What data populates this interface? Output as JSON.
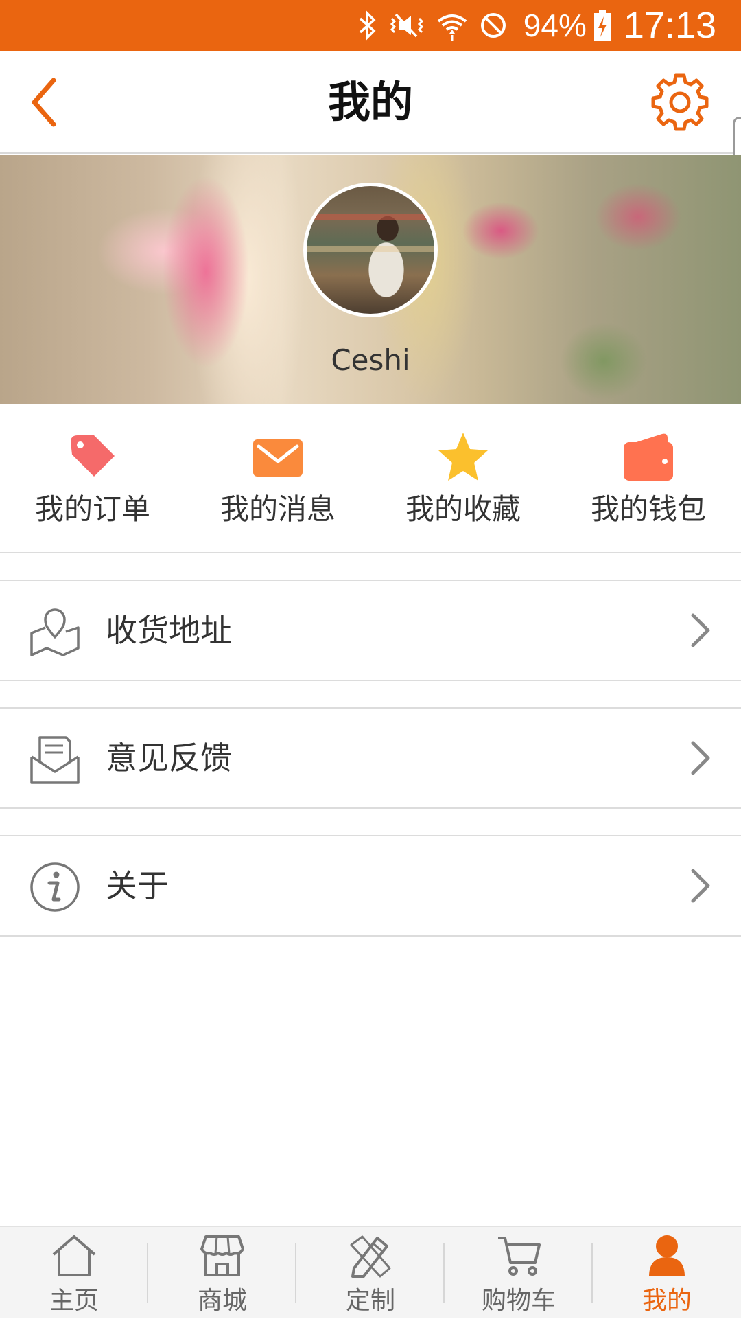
{
  "status_bar": {
    "battery": "94%",
    "time": "17:13",
    "icons": [
      "bluetooth-icon",
      "vibrate-icon",
      "wifi-icon",
      "do-not-disturb-icon",
      "battery-charging-icon"
    ]
  },
  "header": {
    "title": "我的",
    "back_icon": "chevron-left-icon",
    "settings_icon": "gear-icon"
  },
  "profile": {
    "username": "Ceshi"
  },
  "quick_actions": [
    {
      "label": "我的订单",
      "icon": "tag-icon",
      "color": "#f56a6a"
    },
    {
      "label": "我的消息",
      "icon": "mail-icon",
      "color": "#fa8a3c"
    },
    {
      "label": "我的收藏",
      "icon": "star-icon",
      "color": "#fbc02d"
    },
    {
      "label": "我的钱包",
      "icon": "wallet-icon",
      "color": "#ff7250"
    }
  ],
  "menu": [
    {
      "label": "收货地址",
      "icon": "map-pin-icon"
    },
    {
      "label": "意见反馈",
      "icon": "envelope-open-icon"
    },
    {
      "label": "关于",
      "icon": "info-icon"
    }
  ],
  "tabs": [
    {
      "label": "主页",
      "icon": "home-icon",
      "active": false
    },
    {
      "label": "商城",
      "icon": "store-icon",
      "active": false
    },
    {
      "label": "定制",
      "icon": "pencil-ruler-icon",
      "active": false
    },
    {
      "label": "购物车",
      "icon": "cart-icon",
      "active": false
    },
    {
      "label": "我的",
      "icon": "user-icon",
      "active": true
    }
  ],
  "colors": {
    "accent": "#ea6510",
    "status_bar": "#ea6510",
    "tab_inactive": "#666666",
    "divider": "#dcdcdc"
  }
}
